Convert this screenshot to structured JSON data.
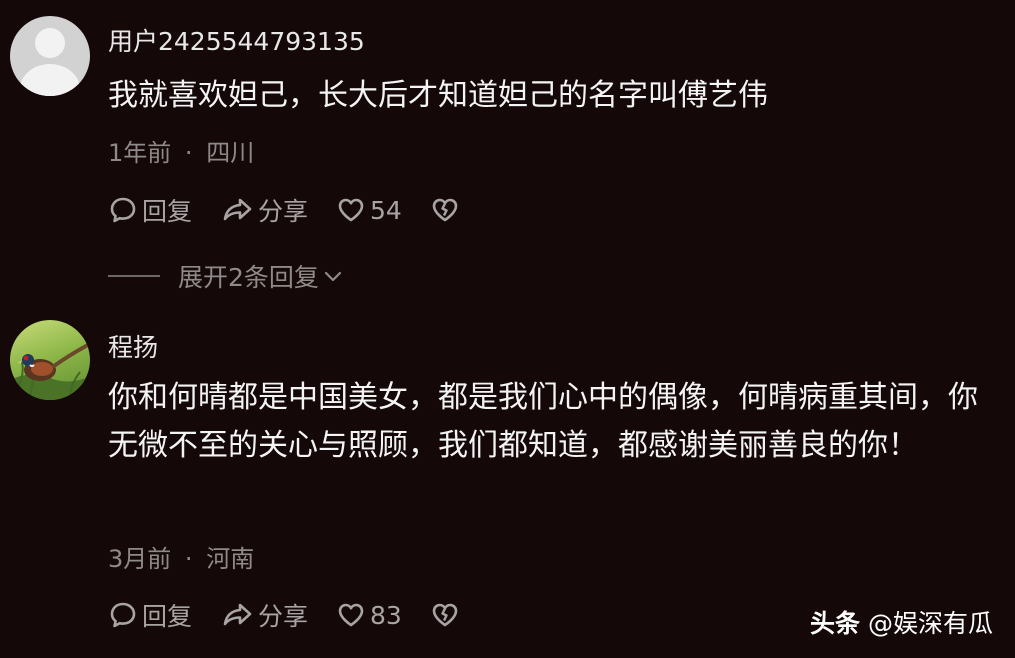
{
  "comments": [
    {
      "username": "用户2425544793135",
      "avatar_icon": "default-user-avatar",
      "text": "我就喜欢妲己，长大后才知道妲己的名字叫傅艺伟",
      "time": "1年前",
      "location": "四川",
      "reply_label": "回复",
      "share_label": "分享",
      "likes": "54",
      "expand_label": "展开2条回复"
    },
    {
      "username": "程扬",
      "avatar_icon": "pheasant-photo-avatar",
      "text": "你和何晴都是中国美女，都是我们心中的偶像，何晴病重其间，你无微不至的关心与照顾，我们都知道，都感谢美丽善良的你！",
      "time": "3月前",
      "location": "河南",
      "reply_label": "回复",
      "share_label": "分享",
      "likes": "83"
    }
  ],
  "meta_separator": "·",
  "watermark": {
    "brand": "头条",
    "handle": "@娱深有瓜"
  },
  "colors": {
    "background": "#150809",
    "text": "#f4f4f4",
    "muted": "#8f8a8a"
  }
}
